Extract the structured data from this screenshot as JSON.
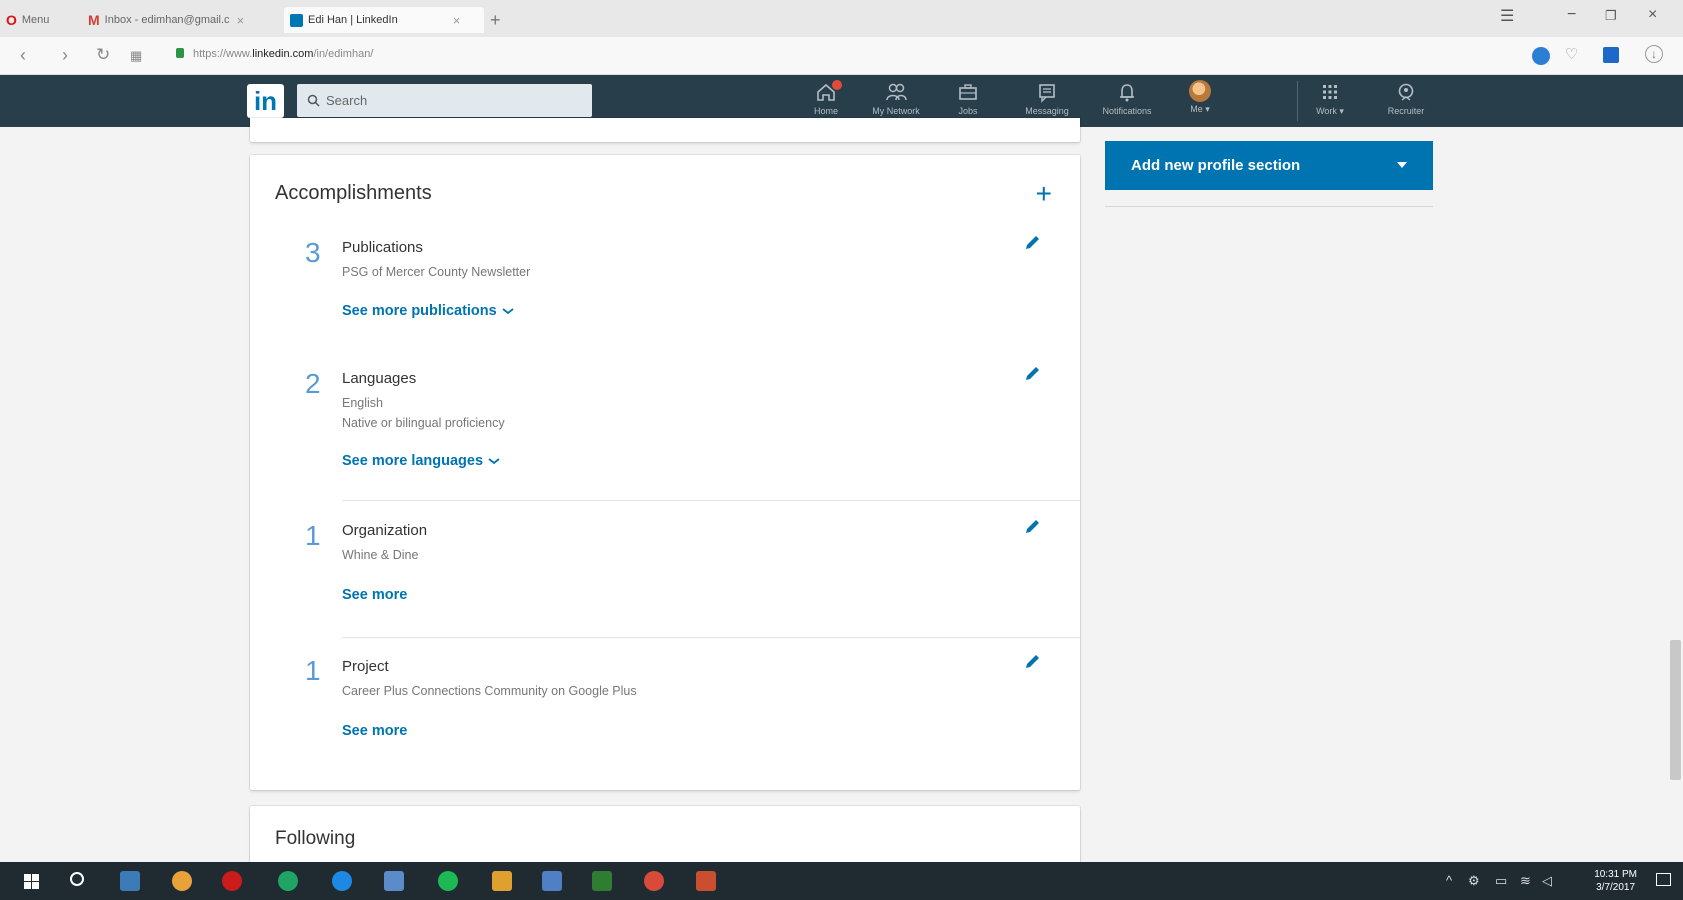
{
  "browser": {
    "menu_label": "Menu",
    "tabs": [
      {
        "label": "Inbox - edimhan@gmail.c"
      },
      {
        "label": "Edi Han | LinkedIn"
      }
    ],
    "url_prefix": "https://www.",
    "url_domain": "linkedin.com",
    "url_path": "/in/edimhan/"
  },
  "nav": {
    "search_placeholder": "Search",
    "items": [
      {
        "label": "Home",
        "icon": "home-icon"
      },
      {
        "label": "My Network",
        "icon": "network-icon"
      },
      {
        "label": "Jobs",
        "icon": "briefcase-icon"
      },
      {
        "label": "Messaging",
        "icon": "messaging-icon"
      },
      {
        "label": "Notifications",
        "icon": "bell-icon"
      },
      {
        "label": "Me ▾",
        "icon": "avatar"
      },
      {
        "label": "Work ▾",
        "icon": "grid-icon"
      },
      {
        "label": "Recruiter",
        "icon": "recruiter-icon"
      }
    ]
  },
  "accomplishments": {
    "title": "Accomplishments",
    "sections": [
      {
        "count": "3",
        "title": "Publications",
        "lines": [
          "PSG of Mercer County Newsletter"
        ],
        "link": "See more publications"
      },
      {
        "count": "2",
        "title": "Languages",
        "lines": [
          "English",
          "Native or bilingual proficiency"
        ],
        "link": "See more languages"
      },
      {
        "count": "1",
        "title": "Organization",
        "lines": [
          "Whine & Dine"
        ],
        "link": "See more"
      },
      {
        "count": "1",
        "title": "Project",
        "lines": [
          "Career Plus Connections Community on Google Plus"
        ],
        "link": "See more"
      }
    ]
  },
  "sidebar": {
    "add_section_label": "Add new profile section"
  },
  "following": {
    "title": "Following"
  },
  "taskbar": {
    "time": "10:31 PM",
    "date": "3/7/2017"
  },
  "colors": {
    "linkedin_nav": "#283e4a",
    "linkedin_blue": "#0073b1",
    "taskbar": "#1f2b31"
  }
}
